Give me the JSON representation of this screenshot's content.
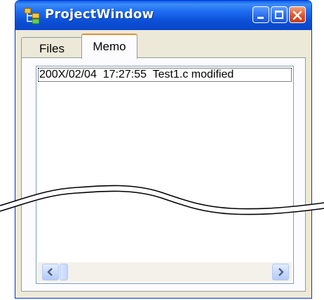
{
  "window": {
    "title": "ProjectWindow",
    "icon": "project-tree-icon",
    "controls": {
      "minimize_icon": "minimize-icon",
      "maximize_icon": "maximize-icon",
      "close_icon": "close-icon"
    }
  },
  "tabs": [
    {
      "label": "Files",
      "selected": false
    },
    {
      "label": "Memo",
      "selected": true
    }
  ],
  "memo_list": {
    "items": [
      {
        "text": "200X/02/04  17:27:55  Test1.c modified"
      }
    ]
  },
  "scrollbar": {
    "left_icon": "scroll-left-arrow-icon",
    "right_icon": "scroll-right-arrow-icon"
  },
  "colors": {
    "titlebar": "#0a4fd6",
    "close_button": "#e0542a",
    "selected_tab_accent": "#e68b2c",
    "window_face": "#ece9d8"
  }
}
